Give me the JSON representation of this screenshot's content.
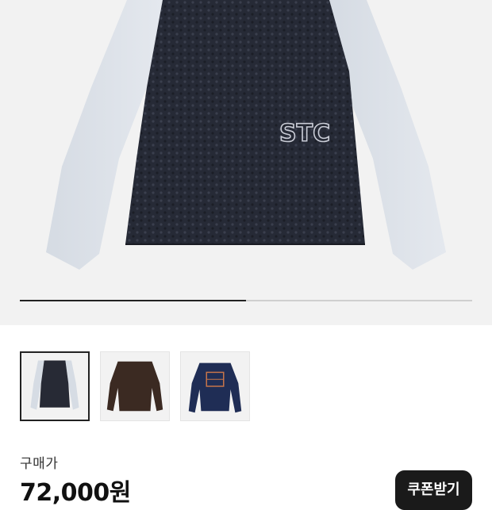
{
  "gallery": {
    "progress_fraction": 0.5,
    "main_logo_text": "STC",
    "thumbnails": [
      {
        "name": "thumb-grey-navy-raglan",
        "selected": true
      },
      {
        "name": "thumb-brown-longsleeve",
        "selected": false
      },
      {
        "name": "thumb-navy-graphic-sweatshirt",
        "selected": false
      }
    ]
  },
  "price": {
    "label": "구매가",
    "value": "72,000원"
  },
  "coupon_button": {
    "label": "쿠폰받기"
  },
  "colors": {
    "hero_bg": "#f2f2f2",
    "sleeve": "#d9dee6",
    "body": "#272a35",
    "button_bg": "#1a1a1a"
  }
}
